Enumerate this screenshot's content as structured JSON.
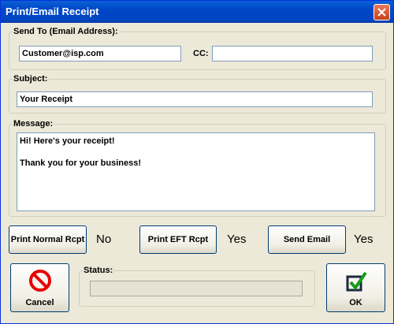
{
  "window": {
    "title": "Print/Email Receipt"
  },
  "send_to": {
    "legend": "Send To (Email Address):",
    "email_value": "Customer@isp.com",
    "cc_label": "CC:",
    "cc_value": ""
  },
  "subject": {
    "legend": "Subject:",
    "value": "Your Receipt"
  },
  "message": {
    "legend": "Message:",
    "value": "Hi! Here's your receipt!\n\nThank you for your business!"
  },
  "actions": {
    "print_normal_label": "Print Normal Rcpt",
    "print_normal_value": "No",
    "print_eft_label": "Print EFT Rcpt",
    "print_eft_value": "Yes",
    "send_email_label": "Send Email",
    "send_email_value": "Yes"
  },
  "status": {
    "legend": "Status:",
    "value": ""
  },
  "buttons": {
    "cancel_label": "Cancel",
    "ok_label": "OK"
  },
  "icons": {
    "close": "close-icon",
    "cancel": "no-entry-icon",
    "ok": "checkmark-icon"
  },
  "colors": {
    "titlebar": "#0047c6",
    "cancel_red": "#e60000",
    "ok_green": "#1a9a1a"
  }
}
